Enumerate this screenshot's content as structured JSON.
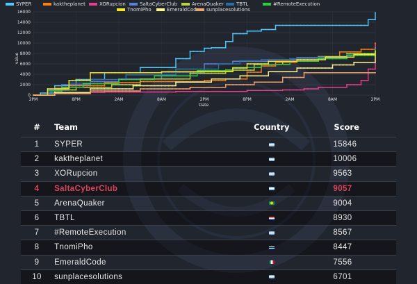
{
  "chart_data": {
    "type": "line",
    "title": "",
    "xlabel": "Date",
    "ylabel": "value",
    "ylim": [
      0,
      16000
    ],
    "yticks": [
      0,
      2000,
      4000,
      6000,
      8000,
      10000,
      12000,
      14000,
      16000
    ],
    "x_tick_labels": [
      "2PM",
      "8PM",
      "2AM",
      "8AM",
      "2PM",
      "8PM",
      "2AM",
      "8AM",
      "2PM"
    ],
    "x_tick_hours": [
      0,
      6,
      12,
      18,
      24,
      30,
      36,
      42,
      48
    ],
    "legend_position": "top",
    "grid": true,
    "series": [
      {
        "name": "SYPER",
        "color": "#4dc9ff",
        "points": [
          [
            0,
            0
          ],
          [
            1,
            400
          ],
          [
            3,
            1800
          ],
          [
            6,
            3000
          ],
          [
            10,
            4300
          ],
          [
            15,
            5300
          ],
          [
            20,
            7000
          ],
          [
            22,
            8400
          ],
          [
            24,
            9000
          ],
          [
            25,
            9100
          ],
          [
            27,
            10300
          ],
          [
            28,
            11800
          ],
          [
            30,
            12300
          ],
          [
            32,
            12600
          ],
          [
            34,
            13400
          ],
          [
            46,
            13400
          ],
          [
            47,
            14500
          ],
          [
            48,
            15846
          ]
        ]
      },
      {
        "name": "kaktheplanet",
        "color": "#ff7f0e",
        "points": [
          [
            0,
            0
          ],
          [
            3,
            1300
          ],
          [
            5,
            1800
          ],
          [
            10,
            2400
          ],
          [
            15,
            2600
          ],
          [
            24,
            2800
          ],
          [
            27,
            3100
          ],
          [
            30,
            4400
          ],
          [
            32,
            5600
          ],
          [
            34,
            6300
          ],
          [
            37,
            6600
          ],
          [
            40,
            7200
          ],
          [
            43,
            8300
          ],
          [
            46,
            8800
          ],
          [
            48,
            10006
          ]
        ]
      },
      {
        "name": "XORupcion",
        "color": "#e83e8c",
        "points": [
          [
            0,
            0
          ],
          [
            3,
            500
          ],
          [
            10,
            600
          ],
          [
            20,
            700
          ],
          [
            30,
            900
          ],
          [
            35,
            1000
          ],
          [
            38,
            1200
          ],
          [
            40,
            1500
          ],
          [
            44,
            2000
          ],
          [
            46,
            2800
          ],
          [
            47,
            5000
          ],
          [
            48,
            9563
          ]
        ]
      },
      {
        "name": "SaltaCyberClub",
        "color": "#5a7fd6",
        "points": [
          [
            0,
            0
          ],
          [
            2,
            1000
          ],
          [
            4,
            2000
          ],
          [
            8,
            2600
          ],
          [
            12,
            3100
          ],
          [
            18,
            4400
          ],
          [
            24,
            6000
          ],
          [
            28,
            6500
          ],
          [
            33,
            6800
          ],
          [
            37,
            7200
          ],
          [
            41,
            7200
          ],
          [
            44,
            7700
          ],
          [
            48,
            9057
          ]
        ]
      },
      {
        "name": "ArenaQuaker",
        "color": "#bcd33a",
        "points": [
          [
            0,
            0
          ],
          [
            3,
            1000
          ],
          [
            6,
            1500
          ],
          [
            11,
            2000
          ],
          [
            15,
            3100
          ],
          [
            22,
            4200
          ],
          [
            27,
            4800
          ],
          [
            31,
            5900
          ],
          [
            35,
            6500
          ],
          [
            40,
            7400
          ],
          [
            44,
            8000
          ],
          [
            48,
            9004
          ]
        ]
      },
      {
        "name": "TBTL",
        "color": "#2a6fa8",
        "points": [
          [
            0,
            0
          ],
          [
            2,
            900
          ],
          [
            5,
            2300
          ],
          [
            8,
            3000
          ],
          [
            13,
            3900
          ],
          [
            20,
            5000
          ],
          [
            26,
            6000
          ],
          [
            29,
            6600
          ],
          [
            32,
            6800
          ],
          [
            36,
            7000
          ],
          [
            40,
            7300
          ],
          [
            44,
            7800
          ],
          [
            48,
            8930
          ]
        ]
      },
      {
        "name": "#RemoteExecution",
        "color": "#2ecc40",
        "points": [
          [
            0,
            0
          ],
          [
            2,
            800
          ],
          [
            4,
            1500
          ],
          [
            7,
            2200
          ],
          [
            12,
            3000
          ],
          [
            17,
            3700
          ],
          [
            23,
            4700
          ],
          [
            28,
            5300
          ],
          [
            32,
            5900
          ],
          [
            36,
            6500
          ],
          [
            40,
            7000
          ],
          [
            44,
            7600
          ],
          [
            48,
            8567
          ]
        ]
      },
      {
        "name": "TnomiPho",
        "color": "#f7e81c",
        "points": [
          [
            0,
            0
          ],
          [
            2,
            1200
          ],
          [
            5,
            2800
          ],
          [
            8,
            4300
          ],
          [
            13,
            4300
          ],
          [
            18,
            4500
          ],
          [
            22,
            4500
          ],
          [
            28,
            5200
          ],
          [
            30,
            6000
          ],
          [
            33,
            6500
          ],
          [
            37,
            6800
          ],
          [
            41,
            7300
          ],
          [
            45,
            7800
          ],
          [
            48,
            8447
          ]
        ]
      },
      {
        "name": "EmeraldCode",
        "color": "#fff68a",
        "points": [
          [
            0,
            0
          ],
          [
            3,
            500
          ],
          [
            8,
            1200
          ],
          [
            14,
            1800
          ],
          [
            20,
            2500
          ],
          [
            25,
            3100
          ],
          [
            29,
            3700
          ],
          [
            33,
            4500
          ],
          [
            37,
            5200
          ],
          [
            42,
            5800
          ],
          [
            45,
            6300
          ],
          [
            48,
            7556
          ]
        ]
      },
      {
        "name": "sunplacesolutions",
        "color": "#f4a261",
        "points": [
          [
            0,
            0
          ],
          [
            3,
            300
          ],
          [
            8,
            800
          ],
          [
            15,
            1200
          ],
          [
            22,
            1500
          ],
          [
            27,
            2000
          ],
          [
            31,
            2500
          ],
          [
            35,
            3400
          ],
          [
            38,
            4300
          ],
          [
            48,
            4300
          ]
        ]
      }
    ]
  },
  "scoreboard": {
    "headers": {
      "rank": "#",
      "team": "Team",
      "country": "Country",
      "score": "Score"
    },
    "rows": [
      {
        "rank": "1",
        "team": "SYPER",
        "score": "15846",
        "flag": "flag-argentina-icon"
      },
      {
        "rank": "2",
        "team": "kaktheplanet",
        "score": "10006",
        "flag": "flag-argentina-icon"
      },
      {
        "rank": "3",
        "team": "XORupcion",
        "score": "9563",
        "flag": "flag-argentina-icon"
      },
      {
        "rank": "4",
        "team": "SaltaCyberClub",
        "score": "9057",
        "flag": "flag-argentina-icon",
        "highlight": true
      },
      {
        "rank": "5",
        "team": "ArenaQuaker",
        "score": "9004",
        "flag": "flag-brazil-icon"
      },
      {
        "rank": "6",
        "team": "TBTL",
        "score": "8930",
        "flag": "flag-paraguay-icon"
      },
      {
        "rank": "7",
        "team": "#RemoteExecution",
        "score": "8567",
        "flag": "flag-argentina-icon"
      },
      {
        "rank": "8",
        "team": "TnomiPho",
        "score": "8447",
        "flag": "flag-uruguay-icon"
      },
      {
        "rank": "9",
        "team": "EmeraldCode",
        "score": "7556",
        "flag": "flag-mexico-icon"
      },
      {
        "rank": "10",
        "team": "sunplacesolutions",
        "score": "6701",
        "flag": "flag-argentina-icon"
      }
    ],
    "highlight_color": "#e0435a"
  }
}
